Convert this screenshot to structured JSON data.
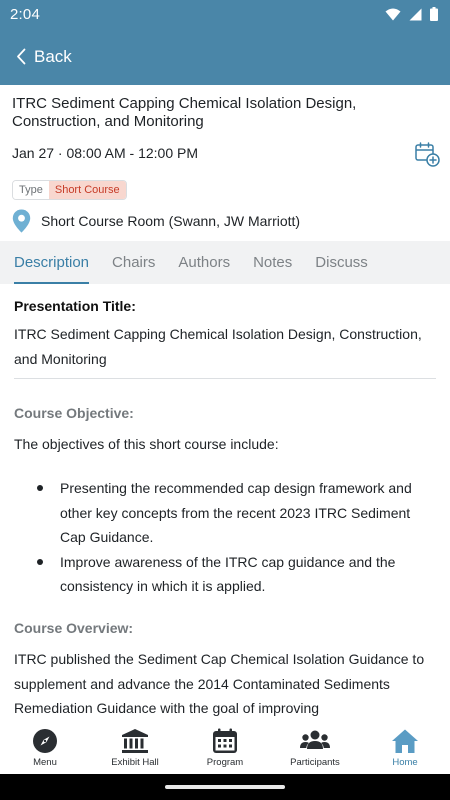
{
  "status_bar": {
    "time": "2:04"
  },
  "app_bar": {
    "back_label": "Back",
    "color": "#4a86a8"
  },
  "event": {
    "title": "ITRC Sediment Capping Chemical Isolation Design, Construction, and Monitoring",
    "datetime": "Jan 27 · 08:00 AM - 12:00 PM",
    "type_key": "Type",
    "type_value": "Short Course",
    "location": "Short Course Room (Swann, JW Marriott)"
  },
  "tabs": [
    {
      "label": "Description",
      "active": true
    },
    {
      "label": "Chairs",
      "active": false
    },
    {
      "label": "Authors",
      "active": false
    },
    {
      "label": "Notes",
      "active": false
    },
    {
      "label": "Discuss",
      "active": false
    }
  ],
  "description": {
    "presentation_title_label": "Presentation Title:",
    "presentation_title": "ITRC Sediment Capping Chemical Isolation Design, Construction, and Monitoring",
    "objective_heading": "Course Objective:",
    "objective_intro": "The objectives of this short course include:",
    "objectives": [
      "Presenting the recommended cap design framework and other key concepts from the recent 2023 ITRC Sediment Cap Guidance.",
      "Improve awareness of the ITRC cap guidance and the consistency in which it is applied."
    ],
    "overview_heading": "Course Overview:",
    "overview_text": "ITRC published the Sediment Cap Chemical Isolation Guidance to supplement and advance the 2014 Contaminated Sediments Remediation Guidance with the goal of improving"
  },
  "bottom_nav": [
    {
      "label": "Menu",
      "icon": "compass-icon",
      "active": false
    },
    {
      "label": "Exhibit Hall",
      "icon": "building-icon",
      "active": false
    },
    {
      "label": "Program",
      "icon": "calendar-icon",
      "active": false
    },
    {
      "label": "Participants",
      "icon": "people-icon",
      "active": false
    },
    {
      "label": "Home",
      "icon": "home-icon",
      "active": true
    }
  ],
  "colors": {
    "accent": "#3a7fa6",
    "tag_bg": "#f8d7cf",
    "tag_text": "#c63b27"
  }
}
